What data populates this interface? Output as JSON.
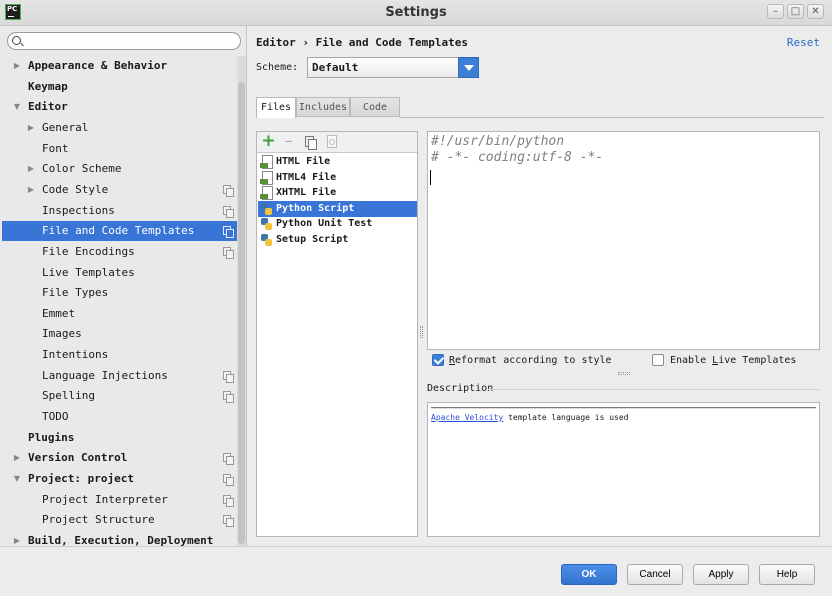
{
  "window": {
    "title": "Settings",
    "logo_text": "PC"
  },
  "search": {
    "placeholder": "",
    "value": ""
  },
  "tree": [
    {
      "label": "Appearance & Behavior",
      "bold": true,
      "arrow": "collapsed",
      "indent": 0
    },
    {
      "label": "Keymap",
      "bold": true,
      "arrow": "none",
      "indent": 0
    },
    {
      "label": "Editor",
      "bold": true,
      "arrow": "expanded",
      "indent": 0
    },
    {
      "label": "General",
      "bold": false,
      "arrow": "collapsed",
      "indent": 1
    },
    {
      "label": "Font",
      "bold": false,
      "arrow": "none",
      "indent": 1
    },
    {
      "label": "Color Scheme",
      "bold": false,
      "arrow": "collapsed",
      "indent": 1
    },
    {
      "label": "Code Style",
      "bold": false,
      "arrow": "collapsed",
      "indent": 1,
      "project_icon": true
    },
    {
      "label": "Inspections",
      "bold": false,
      "arrow": "none",
      "indent": 1,
      "project_icon": true
    },
    {
      "label": "File and Code Templates",
      "bold": false,
      "arrow": "none",
      "indent": 1,
      "project_icon": true,
      "selected": true
    },
    {
      "label": "File Encodings",
      "bold": false,
      "arrow": "none",
      "indent": 1,
      "project_icon": true
    },
    {
      "label": "Live Templates",
      "bold": false,
      "arrow": "none",
      "indent": 1
    },
    {
      "label": "File Types",
      "bold": false,
      "arrow": "none",
      "indent": 1
    },
    {
      "label": "Emmet",
      "bold": false,
      "arrow": "none",
      "indent": 1
    },
    {
      "label": "Images",
      "bold": false,
      "arrow": "none",
      "indent": 1
    },
    {
      "label": "Intentions",
      "bold": false,
      "arrow": "none",
      "indent": 1
    },
    {
      "label": "Language Injections",
      "bold": false,
      "arrow": "none",
      "indent": 1,
      "project_icon": true
    },
    {
      "label": "Spelling",
      "bold": false,
      "arrow": "none",
      "indent": 1,
      "project_icon": true
    },
    {
      "label": "TODO",
      "bold": false,
      "arrow": "none",
      "indent": 1
    },
    {
      "label": "Plugins",
      "bold": true,
      "arrow": "none",
      "indent": 0
    },
    {
      "label": "Version Control",
      "bold": true,
      "arrow": "collapsed",
      "indent": 0,
      "project_icon": true
    },
    {
      "label": "Project: project",
      "bold": true,
      "arrow": "expanded",
      "indent": 0,
      "project_icon": true
    },
    {
      "label": "Project Interpreter",
      "bold": false,
      "arrow": "none",
      "indent": 1,
      "project_icon": true
    },
    {
      "label": "Project Structure",
      "bold": false,
      "arrow": "none",
      "indent": 1,
      "project_icon": true
    },
    {
      "label": "Build, Execution, Deployment",
      "bold": true,
      "arrow": "collapsed",
      "indent": 0
    }
  ],
  "header": {
    "breadcrumb_parent": "Editor",
    "breadcrumb_sep": "›",
    "breadcrumb_current": "File and Code Templates",
    "reset_label": "Reset"
  },
  "scheme": {
    "label": "Scheme:",
    "value": "Default"
  },
  "tabs": [
    {
      "label": "Files",
      "active": true
    },
    {
      "label": "Includes",
      "active": false
    },
    {
      "label": "Code",
      "active": false
    }
  ],
  "templates": [
    {
      "label": "HTML File",
      "icon": "html-file-icon"
    },
    {
      "label": "HTML4 File",
      "icon": "html-file-icon"
    },
    {
      "label": "XHTML File",
      "icon": "html-file-icon"
    },
    {
      "label": "Python Script",
      "icon": "python-file-icon",
      "selected": true
    },
    {
      "label": "Python Unit Test",
      "icon": "python-file-icon"
    },
    {
      "label": "Setup Script",
      "icon": "python-file-icon"
    }
  ],
  "editor": {
    "lines": [
      "#!/usr/bin/python",
      "# -*- coding:utf-8 -*-"
    ]
  },
  "options": {
    "reformat": {
      "prefix": "",
      "mnemonic": "R",
      "rest": "eformat according to style",
      "checked": true
    },
    "live_templates": {
      "prefix": "Enable ",
      "mnemonic": "L",
      "rest": "ive Templates",
      "checked": false
    }
  },
  "description": {
    "label": "Description",
    "link_text": "Apache Velocity",
    "text": " template language is used"
  },
  "buttons": {
    "ok": "OK",
    "cancel": "Cancel",
    "apply": "Apply",
    "help": "Help"
  },
  "colors": {
    "selection": "#3875d7",
    "accent": "#3c7fd6",
    "link": "#2a4fd6"
  }
}
